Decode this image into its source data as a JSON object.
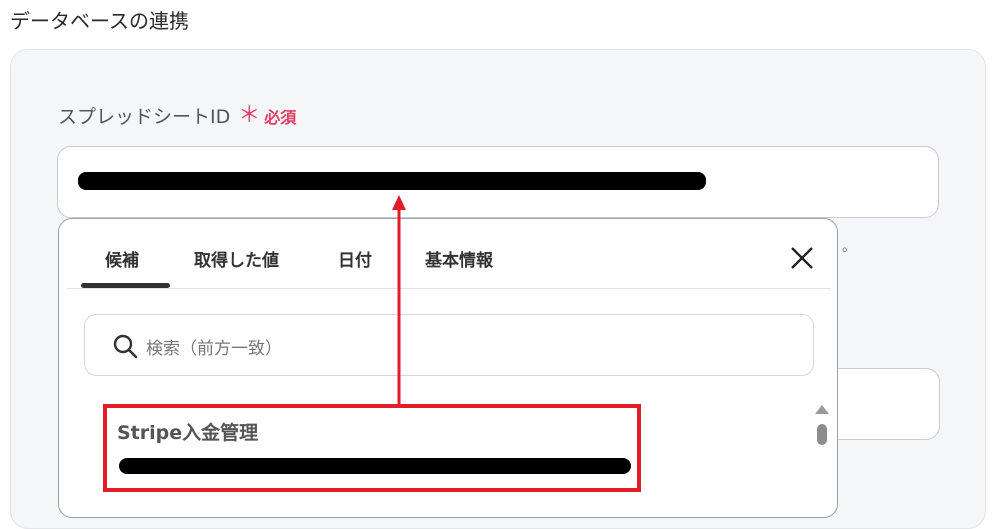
{
  "section": {
    "title": "データベースの連携"
  },
  "field": {
    "label": "スプレッドシートID",
    "required_star": "＊",
    "required_text": "必須"
  },
  "hint_tail": "。",
  "popup": {
    "tabs": [
      {
        "label": "候補",
        "active": true
      },
      {
        "label": "取得した値",
        "active": false
      },
      {
        "label": "日付",
        "active": false
      },
      {
        "label": "基本情報",
        "active": false
      }
    ],
    "search": {
      "placeholder": "検索（前方一致）"
    },
    "results": [
      {
        "title": "Stripe入金管理"
      }
    ]
  },
  "icons": {
    "close": "close-icon",
    "search": "search-icon",
    "scroll_up": "scroll-up-arrow-icon"
  },
  "colors": {
    "required": "#e23d63",
    "highlight": "#e21c2a",
    "card_bg": "#f5f6f8"
  }
}
